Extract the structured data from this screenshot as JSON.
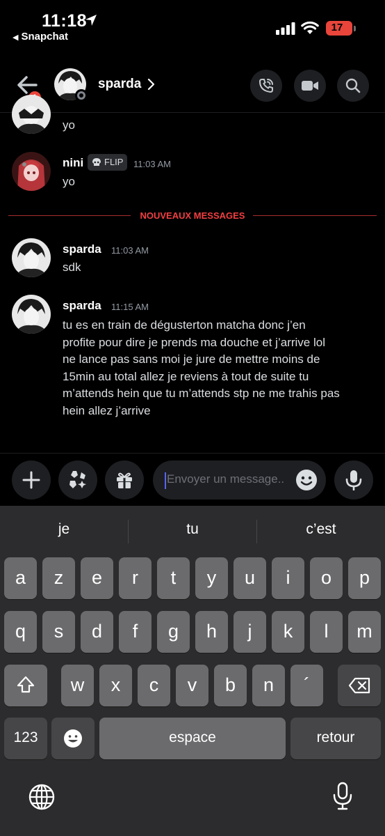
{
  "status_bar": {
    "time": "11:18",
    "back_app": "Snapchat",
    "battery": "17"
  },
  "header": {
    "badge": "1",
    "name": "sparda"
  },
  "messages": [
    {
      "author": "",
      "time": "",
      "text": "yo"
    },
    {
      "author": "nini",
      "tag": "FLIP",
      "time": "11:03 AM",
      "text": "yo"
    },
    {
      "author": "sparda",
      "time": "11:03 AM",
      "text": "sdk"
    },
    {
      "author": "sparda",
      "time": "11:15 AM",
      "lines": [
        "tu es en train de dégusterton matcha donc j’en",
        "profite pour dire je prends ma douche et j’arrive lol",
        "ne lance pas sans moi je jure de mettre moins de",
        "15min au total allez je reviens à tout de suite tu",
        "m’attends hein que tu m’attends stp ne me trahis pas",
        "hein allez j’arrive"
      ]
    }
  ],
  "divider": "NOUVEAUX MESSAGES",
  "composer": {
    "placeholder": "Envoyer un message.."
  },
  "keyboard": {
    "suggestions": [
      "je",
      "tu",
      "c’est"
    ],
    "row1": [
      "a",
      "z",
      "e",
      "r",
      "t",
      "y",
      "u",
      "i",
      "o",
      "p"
    ],
    "row2": [
      "q",
      "s",
      "d",
      "f",
      "g",
      "h",
      "j",
      "k",
      "l",
      "m"
    ],
    "row3": [
      "w",
      "x",
      "c",
      "v",
      "b",
      "n",
      "´"
    ],
    "numbers": "123",
    "space": "espace",
    "return": "retour"
  },
  "icons": [
    "location-arrow-icon",
    "signal-icon",
    "wifi-icon",
    "back-arrow-icon",
    "chevron-right-icon",
    "phone-call-icon",
    "video-camera-icon",
    "search-icon",
    "plus-icon",
    "apps-icon",
    "gift-icon",
    "emoji-icon",
    "microphone-icon",
    "shift-icon",
    "backspace-icon",
    "globe-icon",
    "dictation-icon"
  ],
  "colors": {
    "accent_red": "#f23f42",
    "surface": "#1e1f22",
    "key": "#6b6b6d",
    "keyboard_bg": "#2c2c2e"
  }
}
